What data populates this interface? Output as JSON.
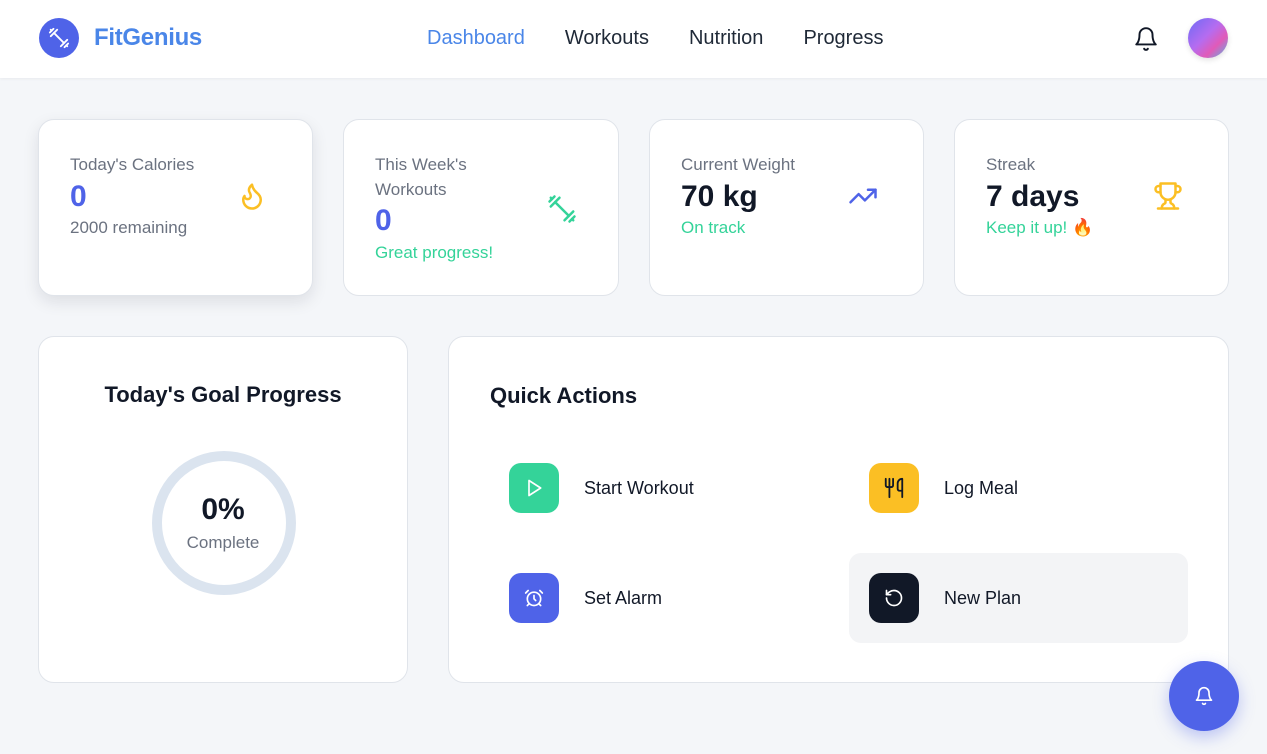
{
  "brand": {
    "name": "FitGenius"
  },
  "nav": {
    "items": [
      {
        "label": "Dashboard",
        "active": true
      },
      {
        "label": "Workouts",
        "active": false
      },
      {
        "label": "Nutrition",
        "active": false
      },
      {
        "label": "Progress",
        "active": false
      }
    ]
  },
  "stats": {
    "calories": {
      "label": "Today's Calories",
      "value": "0",
      "sub": "2000 remaining",
      "icon": "flame-icon"
    },
    "workouts": {
      "label": "This Week's Workouts",
      "value": "0",
      "sub": "Great progress!",
      "icon": "dumbbell-icon"
    },
    "weight": {
      "label": "Current Weight",
      "value": "70 kg",
      "sub": "On track",
      "icon": "trending-up-icon"
    },
    "streak": {
      "label": "Streak",
      "value": "7 days",
      "sub": "Keep it up! 🔥",
      "icon": "trophy-icon"
    }
  },
  "goal": {
    "title": "Today's Goal Progress",
    "percent_text": "0%",
    "label": "Complete",
    "progress": 0
  },
  "quick_actions": {
    "title": "Quick Actions",
    "items": [
      {
        "label": "Start Workout",
        "icon": "play-icon"
      },
      {
        "label": "Log Meal",
        "icon": "utensils-icon"
      },
      {
        "label": "Set Alarm",
        "icon": "alarm-clock-icon"
      },
      {
        "label": "New Plan",
        "icon": "refresh-icon"
      }
    ]
  },
  "colors": {
    "accent": "#4a86e8",
    "primary": "#4f63e8",
    "success": "#34d399",
    "warning": "#fbbf24",
    "dark": "#111827",
    "ring_track": "#dbe4ef"
  }
}
